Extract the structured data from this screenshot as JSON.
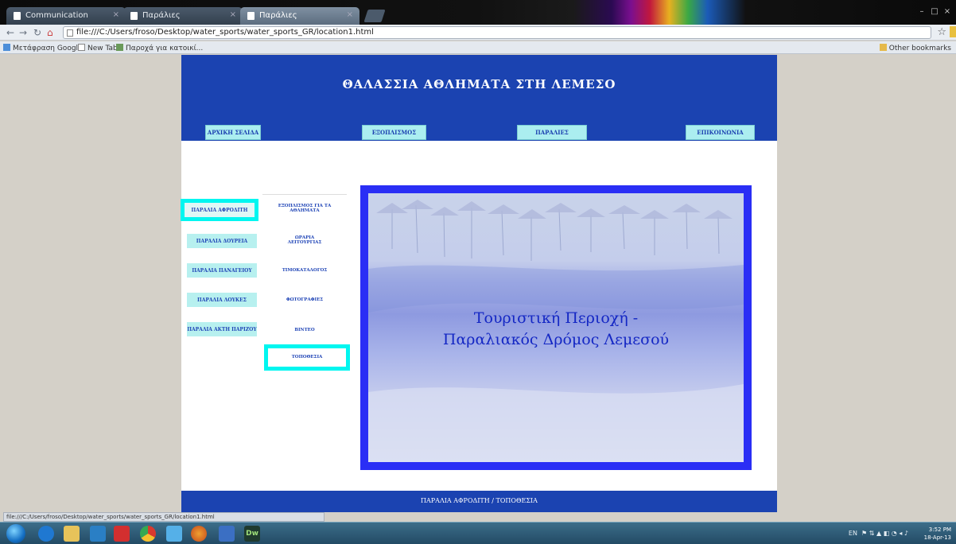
{
  "browser": {
    "tabs": [
      {
        "label": "Communication",
        "active": false
      },
      {
        "label": "Παράλιες",
        "active": false
      },
      {
        "label": "Παράλιες",
        "active": true
      }
    ],
    "url": "file:///C:/Users/froso/Desktop/water_sports/water_sports_GR/location1.html",
    "bookmarks": [
      "Μετάφραση Google",
      "New Tab",
      "Παροχά για κατοικί..."
    ],
    "other_bookmarks": "Other bookmarks",
    "status_url": "file:///C:/Users/froso/Desktop/water_sports/water_sports_GR/location1.html"
  },
  "site": {
    "title": "ΘΑΛΑΣΣΙΑ ΑΘΛΗΜΑΤΑ ΣΤΗ ΛΕΜΕΣΟ",
    "top_nav": [
      "ΑΡΧΙΚΗ ΣΕΛΙΔΑ",
      "ΕΞΟΠΛΙΣΜΟΣ",
      "ΠΑΡΑΛΙΕΣ",
      "ΕΠΙΚΟΙΝΩΝΙΑ"
    ],
    "top_nav_active": "ΠΑΡΑΛΙΕΣ",
    "side_nav": [
      "ΠΑΡΑΛΙΑ ΑΦΡΟΔΙΤΗ",
      "ΠΑΡΑΛΙΑ ΔΟΥΡΕΙΑ",
      "ΠΑΡΑΛΙΑ ΠΑΝΑΓΕΙΟΥ",
      "ΠΑΡΑΛΙΑ ΛΟΥΚΕΣ",
      "ΠΑΡΑΛΙΑ ΑΚΤΗ ΠΑΡΙΖΟΥ"
    ],
    "side_nav_active": "ΠΑΡΑΛΙΑ ΑΦΡΟΔΙΤΗ",
    "sub_nav": [
      "ΕΞΟΠΛΙΣΜΟΣ ΓΙΑ ΤΑ ΑΘΛΗΜΑΤΑ",
      "ΩΡΑΡΙΑ ΛΕΙΤΟΥΡΓΙΑΣ",
      "ΤΙΜΟΚΑΤΑΛΟΓΟΣ",
      "ΦΩΤΟΓΡΑΦΙΕΣ",
      "ΒΙΝΤΕΟ",
      "ΤΟΠΟΘΕΣΙΑ"
    ],
    "sub_nav_active": "ΤΟΠΟΘΕΣΙΑ",
    "hero_caption_line1": "Τουριστική Περιοχή -",
    "hero_caption_line2": "Παραλιακός Δρόμος Λεμεσού",
    "footer": "ΠΑΡΑΛΙΑ ΑΦΡΟΔΙΤΗ / ΤΟΠΟΘΕΣΙΑ"
  },
  "taskbar": {
    "apps": [
      "start-orb",
      "ie-icon",
      "explorer-icon",
      "media-player-icon",
      "acrobat-icon",
      "chrome-icon",
      "msn-icon",
      "firefox-icon",
      "word-icon",
      "dreamweaver-icon"
    ],
    "dreamweaver_label": "Dw",
    "lang": "EN",
    "time": "3:52 PM",
    "date": "18-Apr-13"
  },
  "colors": {
    "header_blue": "#1b43b1",
    "nav_cyan": "#abeef0",
    "highlight_cyan": "#00f6f0",
    "hero_frame": "#2a2ef5"
  }
}
